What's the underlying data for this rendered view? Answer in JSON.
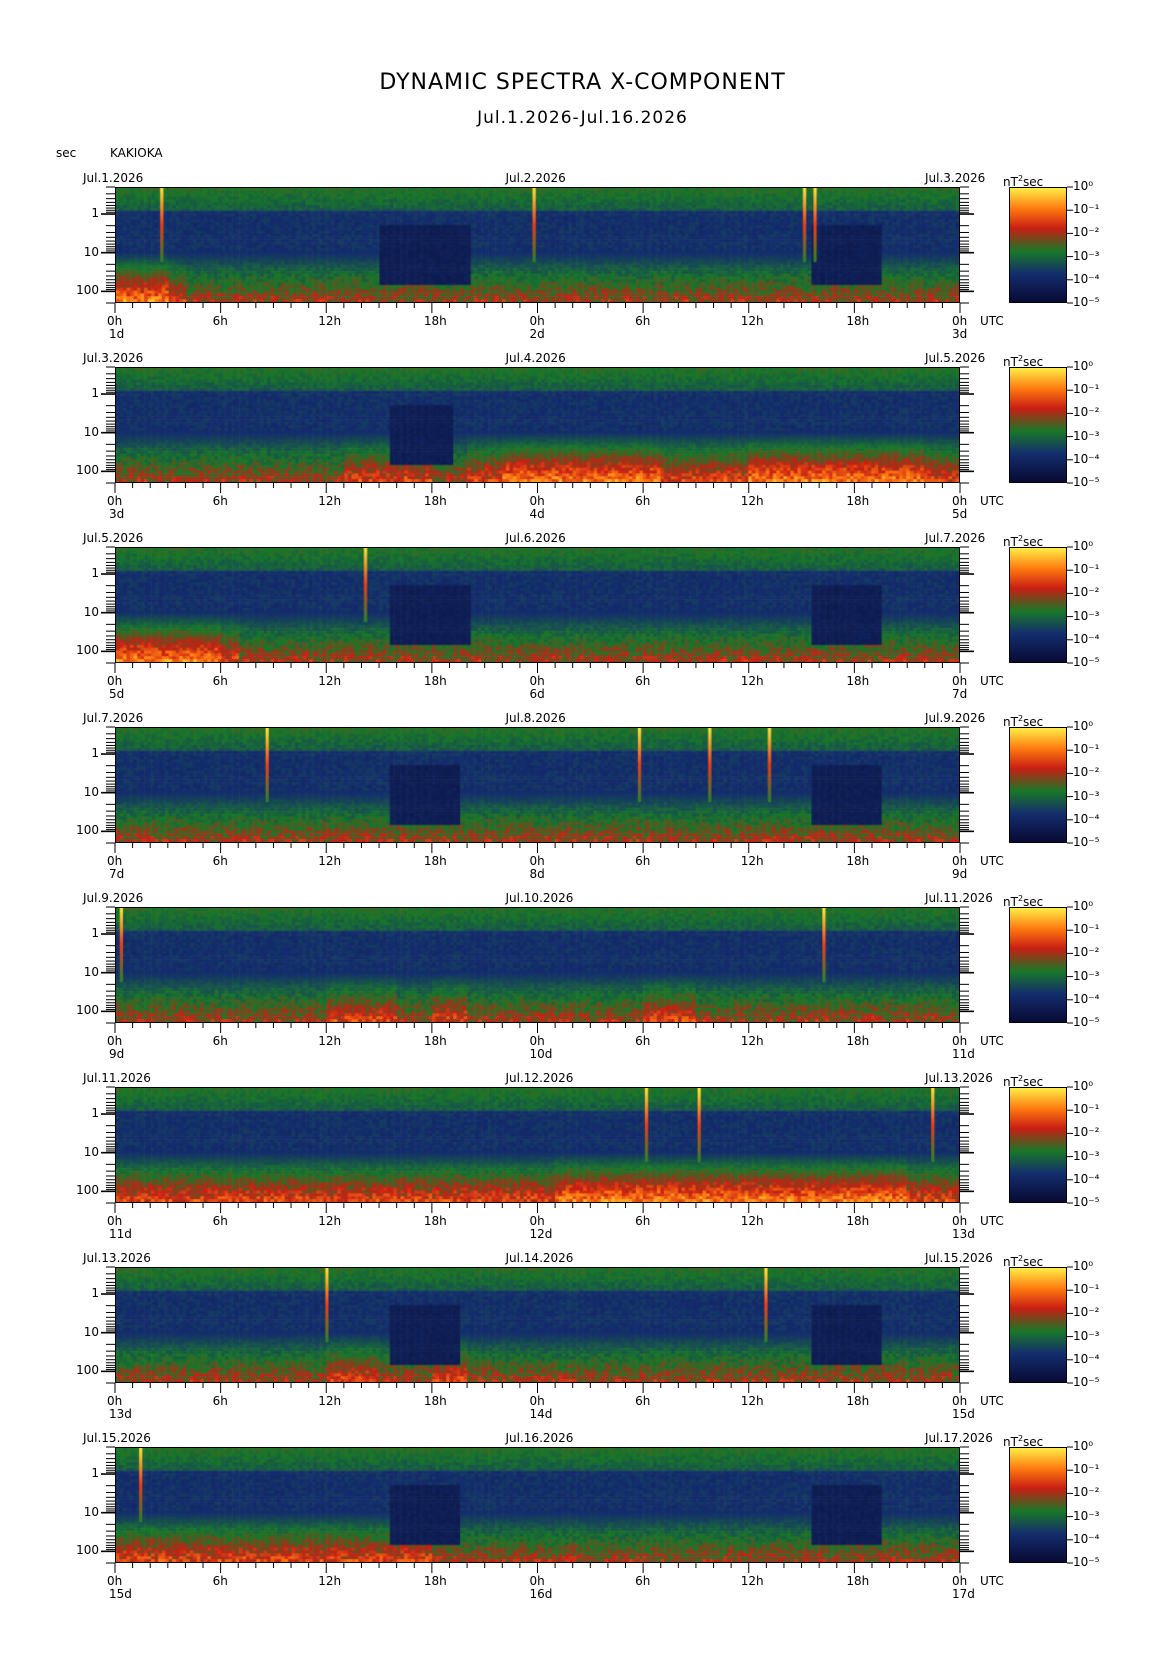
{
  "title": "DYNAMIC SPECTRA X-COMPONENT",
  "subtitle": "Jul.1.2026-Jul.16.2026",
  "y_unit_label": "sec",
  "station": "KAKIOKA",
  "colorbar_unit": "nT",
  "colorbar_unit_exp": "2",
  "colorbar_unit_suffix": "sec",
  "utc_label": "UTC",
  "chart_data": {
    "type": "heatmap",
    "title": "DYNAMIC SPECTRA X-COMPONENT",
    "subtitle": "Jul.1.2026-Jul.16.2026",
    "ylabel": "sec",
    "yscale": "log",
    "ylim": [
      0.2,
      200
    ],
    "y_ticks": [
      "1",
      "10",
      "100"
    ],
    "x_ticks": [
      "0h",
      "6h",
      "12h",
      "18h",
      "0h",
      "6h",
      "12h",
      "18h",
      "0h"
    ],
    "colorbar": {
      "label": "nT²sec",
      "scale": "log",
      "range": [
        1e-05,
        1.0
      ],
      "ticks": [
        "10⁰",
        "10⁻¹",
        "10⁻²",
        "10⁻³",
        "10⁻⁴",
        "10⁻⁵"
      ],
      "colors": [
        "#0a0a3a",
        "#1a3a8a",
        "#1d7a2a",
        "#e0201a",
        "#ff7a10",
        "#ffe040"
      ]
    },
    "panels": [
      {
        "left": "Jul.1.2026",
        "mid": "Jul.2.2026",
        "right": "Jul.3.2026",
        "day_left": "1d",
        "day_mid": "2d",
        "day_right": "3d",
        "spikes": [
          2.6,
          23.8,
          39.2,
          39.8
        ],
        "activity": [
          3,
          3,
          3,
          2,
          1,
          1,
          1,
          1,
          1,
          1,
          1,
          1,
          1,
          1,
          1,
          1,
          1,
          1,
          1,
          1,
          1,
          1,
          1,
          1,
          1,
          1,
          1,
          1,
          1,
          1,
          1,
          1,
          1,
          1,
          1,
          1,
          1,
          1,
          1,
          1,
          1,
          1,
          1,
          1,
          1,
          1,
          1,
          1
        ],
        "quiet": [
          [
            15,
            20
          ],
          [
            39.5,
            43.5
          ]
        ]
      },
      {
        "left": "Jul.3.2026",
        "mid": "Jul.4.2026",
        "right": "Jul.5.2026",
        "day_left": "3d",
        "day_mid": "4d",
        "day_right": "5d",
        "spikes": [],
        "activity": [
          1,
          1,
          1,
          1,
          1,
          1,
          1,
          1,
          1,
          1,
          1,
          1,
          1,
          2,
          2,
          2,
          2,
          2,
          1,
          1,
          2,
          2,
          3,
          3,
          3,
          3,
          3,
          3,
          3,
          3,
          3,
          2,
          2,
          2,
          2,
          2,
          3,
          3,
          3,
          3,
          3,
          3,
          3,
          3,
          3,
          3,
          2,
          2
        ],
        "quiet": [
          [
            15.5,
            19
          ]
        ]
      },
      {
        "left": "Jul.5.2026",
        "mid": "Jul.6.2026",
        "right": "Jul.7.2026",
        "day_left": "5d",
        "day_mid": "6d",
        "day_right": "7d",
        "spikes": [
          14.2
        ],
        "activity": [
          3,
          3,
          3,
          3,
          3,
          3,
          2,
          1,
          1,
          1,
          1,
          1,
          1,
          1,
          1,
          1,
          1,
          1,
          1,
          1,
          1,
          1,
          1,
          1,
          1,
          1,
          1,
          1,
          1,
          1,
          1,
          1,
          1,
          1,
          1,
          1,
          1,
          1,
          1,
          1,
          1,
          1,
          1,
          1,
          1,
          1,
          1,
          1
        ],
        "quiet": [
          [
            15.5,
            20
          ],
          [
            39.5,
            43.5
          ]
        ]
      },
      {
        "left": "Jul.7.2026",
        "mid": "Jul.8.2026",
        "right": "Jul.9.2026",
        "day_left": "7d",
        "day_mid": "8d",
        "day_right": "9d",
        "spikes": [
          8.6,
          29.8,
          33.8,
          37.2
        ],
        "activity": [
          1,
          1,
          1,
          1,
          1,
          1,
          1,
          1,
          1,
          1,
          1,
          1,
          1,
          1,
          1,
          1,
          1,
          1,
          1,
          1,
          1,
          1,
          1,
          1,
          1,
          1,
          1,
          1,
          1,
          1,
          1,
          1,
          1,
          1,
          1,
          1,
          1,
          1,
          1,
          1,
          1,
          1,
          1,
          1,
          1,
          1,
          1,
          1
        ],
        "quiet": [
          [
            15.5,
            19.5
          ],
          [
            39.5,
            43.5
          ]
        ]
      },
      {
        "left": "Jul.9.2026",
        "mid": "Jul.10.2026",
        "right": "Jul.11.2026",
        "day_left": "9d",
        "day_mid": "10d",
        "day_right": "11d",
        "spikes": [
          0.3,
          40.3
        ],
        "activity": [
          1,
          1,
          1,
          1,
          1,
          1,
          1,
          1,
          1,
          1,
          1,
          1,
          2,
          2,
          2,
          2,
          1,
          1,
          2,
          2,
          1,
          1,
          1,
          1,
          1,
          1,
          1,
          1,
          1,
          1,
          2,
          2,
          2,
          1,
          1,
          1,
          1,
          1,
          1,
          1,
          1,
          1,
          1,
          1,
          1,
          1,
          1,
          1
        ],
        "quiet": []
      },
      {
        "left": "Jul.11.2026",
        "mid": "Jul.12.2026",
        "right": "Jul.13.2026",
        "day_left": "11d",
        "day_mid": "12d",
        "day_right": "13d",
        "spikes": [
          30.2,
          33.2,
          46.5
        ],
        "activity": [
          2,
          2,
          2,
          2,
          2,
          2,
          2,
          2,
          2,
          2,
          2,
          2,
          2,
          2,
          2,
          2,
          2,
          2,
          2,
          2,
          2,
          2,
          2,
          2,
          2,
          3,
          3,
          3,
          3,
          3,
          3,
          3,
          3,
          3,
          3,
          3,
          3,
          3,
          3,
          3,
          3,
          3,
          3,
          3,
          3,
          2,
          2,
          2
        ],
        "quiet": []
      },
      {
        "left": "Jul.13.2026",
        "mid": "Jul.14.2026",
        "right": "Jul.15.2026",
        "day_left": "13d",
        "day_mid": "14d",
        "day_right": "15d",
        "spikes": [
          12.0,
          37.0
        ],
        "activity": [
          1,
          1,
          1,
          1,
          1,
          1,
          1,
          1,
          1,
          1,
          1,
          1,
          2,
          2,
          2,
          1,
          1,
          1,
          2,
          2,
          1,
          1,
          1,
          1,
          1,
          1,
          1,
          1,
          1,
          1,
          1,
          1,
          1,
          1,
          1,
          1,
          1,
          1,
          1,
          1,
          1,
          1,
          1,
          1,
          1,
          1,
          1,
          1
        ],
        "quiet": [
          [
            15.5,
            19.5
          ],
          [
            39.5,
            43.5
          ]
        ]
      },
      {
        "left": "Jul.15.2026",
        "mid": "Jul.16.2026",
        "right": "Jul.17.2026",
        "day_left": "15d",
        "day_mid": "16d",
        "day_right": "17d",
        "spikes": [
          1.4
        ],
        "activity": [
          2,
          2,
          2,
          2,
          2,
          2,
          2,
          2,
          2,
          2,
          2,
          2,
          2,
          2,
          2,
          2,
          2,
          2,
          1,
          1,
          1,
          1,
          1,
          1,
          1,
          1,
          1,
          1,
          1,
          1,
          1,
          1,
          1,
          1,
          1,
          1,
          1,
          1,
          1,
          1,
          1,
          1,
          1,
          1,
          1,
          1,
          1,
          1
        ],
        "quiet": [
          [
            15.5,
            19.5
          ],
          [
            39.5,
            43.5
          ]
        ]
      }
    ]
  }
}
